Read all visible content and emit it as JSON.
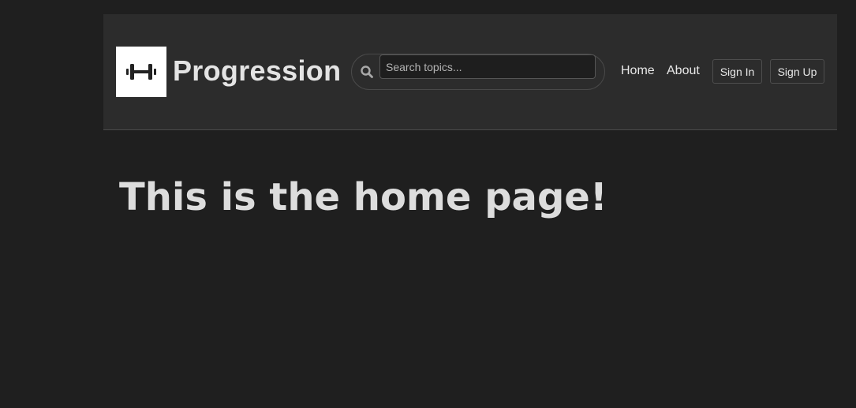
{
  "header": {
    "brand_name": "Progression",
    "logo_icon": "dumbbell-icon",
    "search": {
      "placeholder": "Search topics...",
      "value": "",
      "icon": "search-icon"
    },
    "nav": {
      "home_label": "Home",
      "about_label": "About",
      "sign_in_label": "Sign In",
      "sign_up_label": "Sign Up"
    }
  },
  "main": {
    "heading": "This is the home page!"
  },
  "colors": {
    "page_background": "#1f1f1f",
    "header_background": "#2c2c2c",
    "text": "#e4e4e4"
  }
}
